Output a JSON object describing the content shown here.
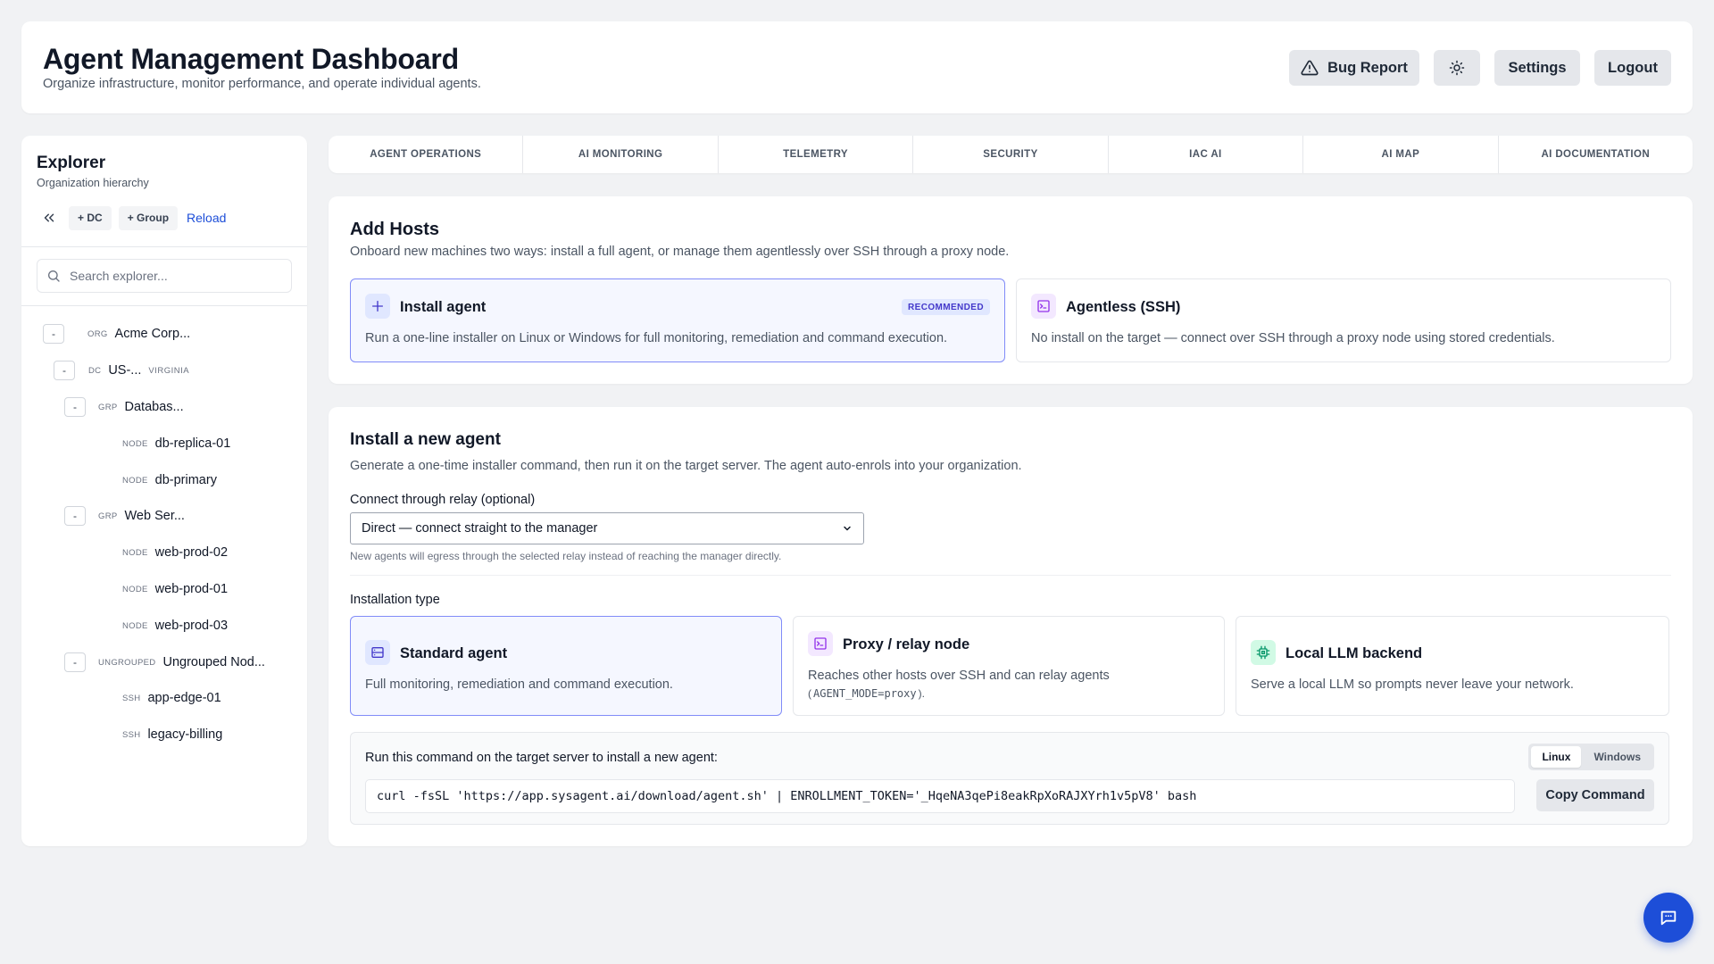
{
  "header": {
    "title": "Agent Management Dashboard",
    "subtitle": "Organize infrastructure, monitor performance, and operate individual agents.",
    "bug_report": "Bug Report",
    "settings": "Settings",
    "logout": "Logout"
  },
  "sidebar": {
    "title": "Explorer",
    "subtitle": "Organization hierarchy",
    "add_dc": "+ DC",
    "add_group": "+ Group",
    "reload": "Reload",
    "search_placeholder": "Search explorer...",
    "tree": [
      {
        "toggle": "-",
        "kind": "ORG",
        "name": "Acme Corp..."
      },
      {
        "toggle": "-",
        "kind": "DC",
        "name": "US-...",
        "location": "VIRGINIA"
      },
      {
        "toggle": "-",
        "kind": "GRP",
        "name": "Databas..."
      },
      {
        "kind": "NODE",
        "name": "db-replica-01"
      },
      {
        "kind": "NODE",
        "name": "db-primary"
      },
      {
        "toggle": "-",
        "kind": "GRP",
        "name": "Web Ser..."
      },
      {
        "kind": "NODE",
        "name": "web-prod-02"
      },
      {
        "kind": "NODE",
        "name": "web-prod-01"
      },
      {
        "kind": "NODE",
        "name": "web-prod-03"
      },
      {
        "toggle": "-",
        "kind": "UNGROUPED",
        "name": "Ungrouped Nod..."
      },
      {
        "kind": "SSH",
        "name": "app-edge-01"
      },
      {
        "kind": "SSH",
        "name": "legacy-billing"
      }
    ]
  },
  "tabs": [
    "AGENT OPERATIONS",
    "AI MONITORING",
    "TELEMETRY",
    "SECURITY",
    "IAC AI",
    "AI MAP",
    "AI DOCUMENTATION"
  ],
  "add_hosts": {
    "title": "Add Hosts",
    "description": "Onboard new machines two ways: install a full agent, or manage them agentlessly over SSH through a proxy node.",
    "install": {
      "title": "Install agent",
      "badge": "RECOMMENDED",
      "description": "Run a one-line installer on Linux or Windows for full monitoring, remediation and command execution."
    },
    "agentless": {
      "title": "Agentless (SSH)",
      "description": "No install on the target — connect over SSH through a proxy node using stored credentials."
    }
  },
  "install_agent": {
    "title": "Install a new agent",
    "description": "Generate a one-time installer command, then run it on the target server. The agent auto-enrols into your organization.",
    "relay_label": "Connect through relay (optional)",
    "relay_value": "Direct — connect straight to the manager",
    "relay_help": "New agents will egress through the selected relay instead of reaching the manager directly.",
    "type_label": "Installation type",
    "types": {
      "standard": {
        "title": "Standard agent",
        "description": "Full monitoring, remediation and command execution."
      },
      "proxy": {
        "title": "Proxy / relay node",
        "description": "Reaches other hosts over SSH and can relay agents",
        "code": "AGENT_MODE=proxy"
      },
      "llm": {
        "title": "Local LLM backend",
        "description": "Serve a local LLM so prompts never leave your network."
      }
    },
    "command_label": "Run this command on the target server to install a new agent:",
    "os_linux": "Linux",
    "os_windows": "Windows",
    "command": "curl -fsSL 'https://app.sysagent.ai/download/agent.sh' | ENROLLMENT_TOKEN='_HqeNA3qePi8eakRpXoRAJXYrh1v5pV8' bash",
    "copy": "Copy Command"
  },
  "colors": {
    "accent": "#1d4ed8",
    "selected_border": "#818cf8",
    "badge_bg": "#e0e7ff"
  }
}
